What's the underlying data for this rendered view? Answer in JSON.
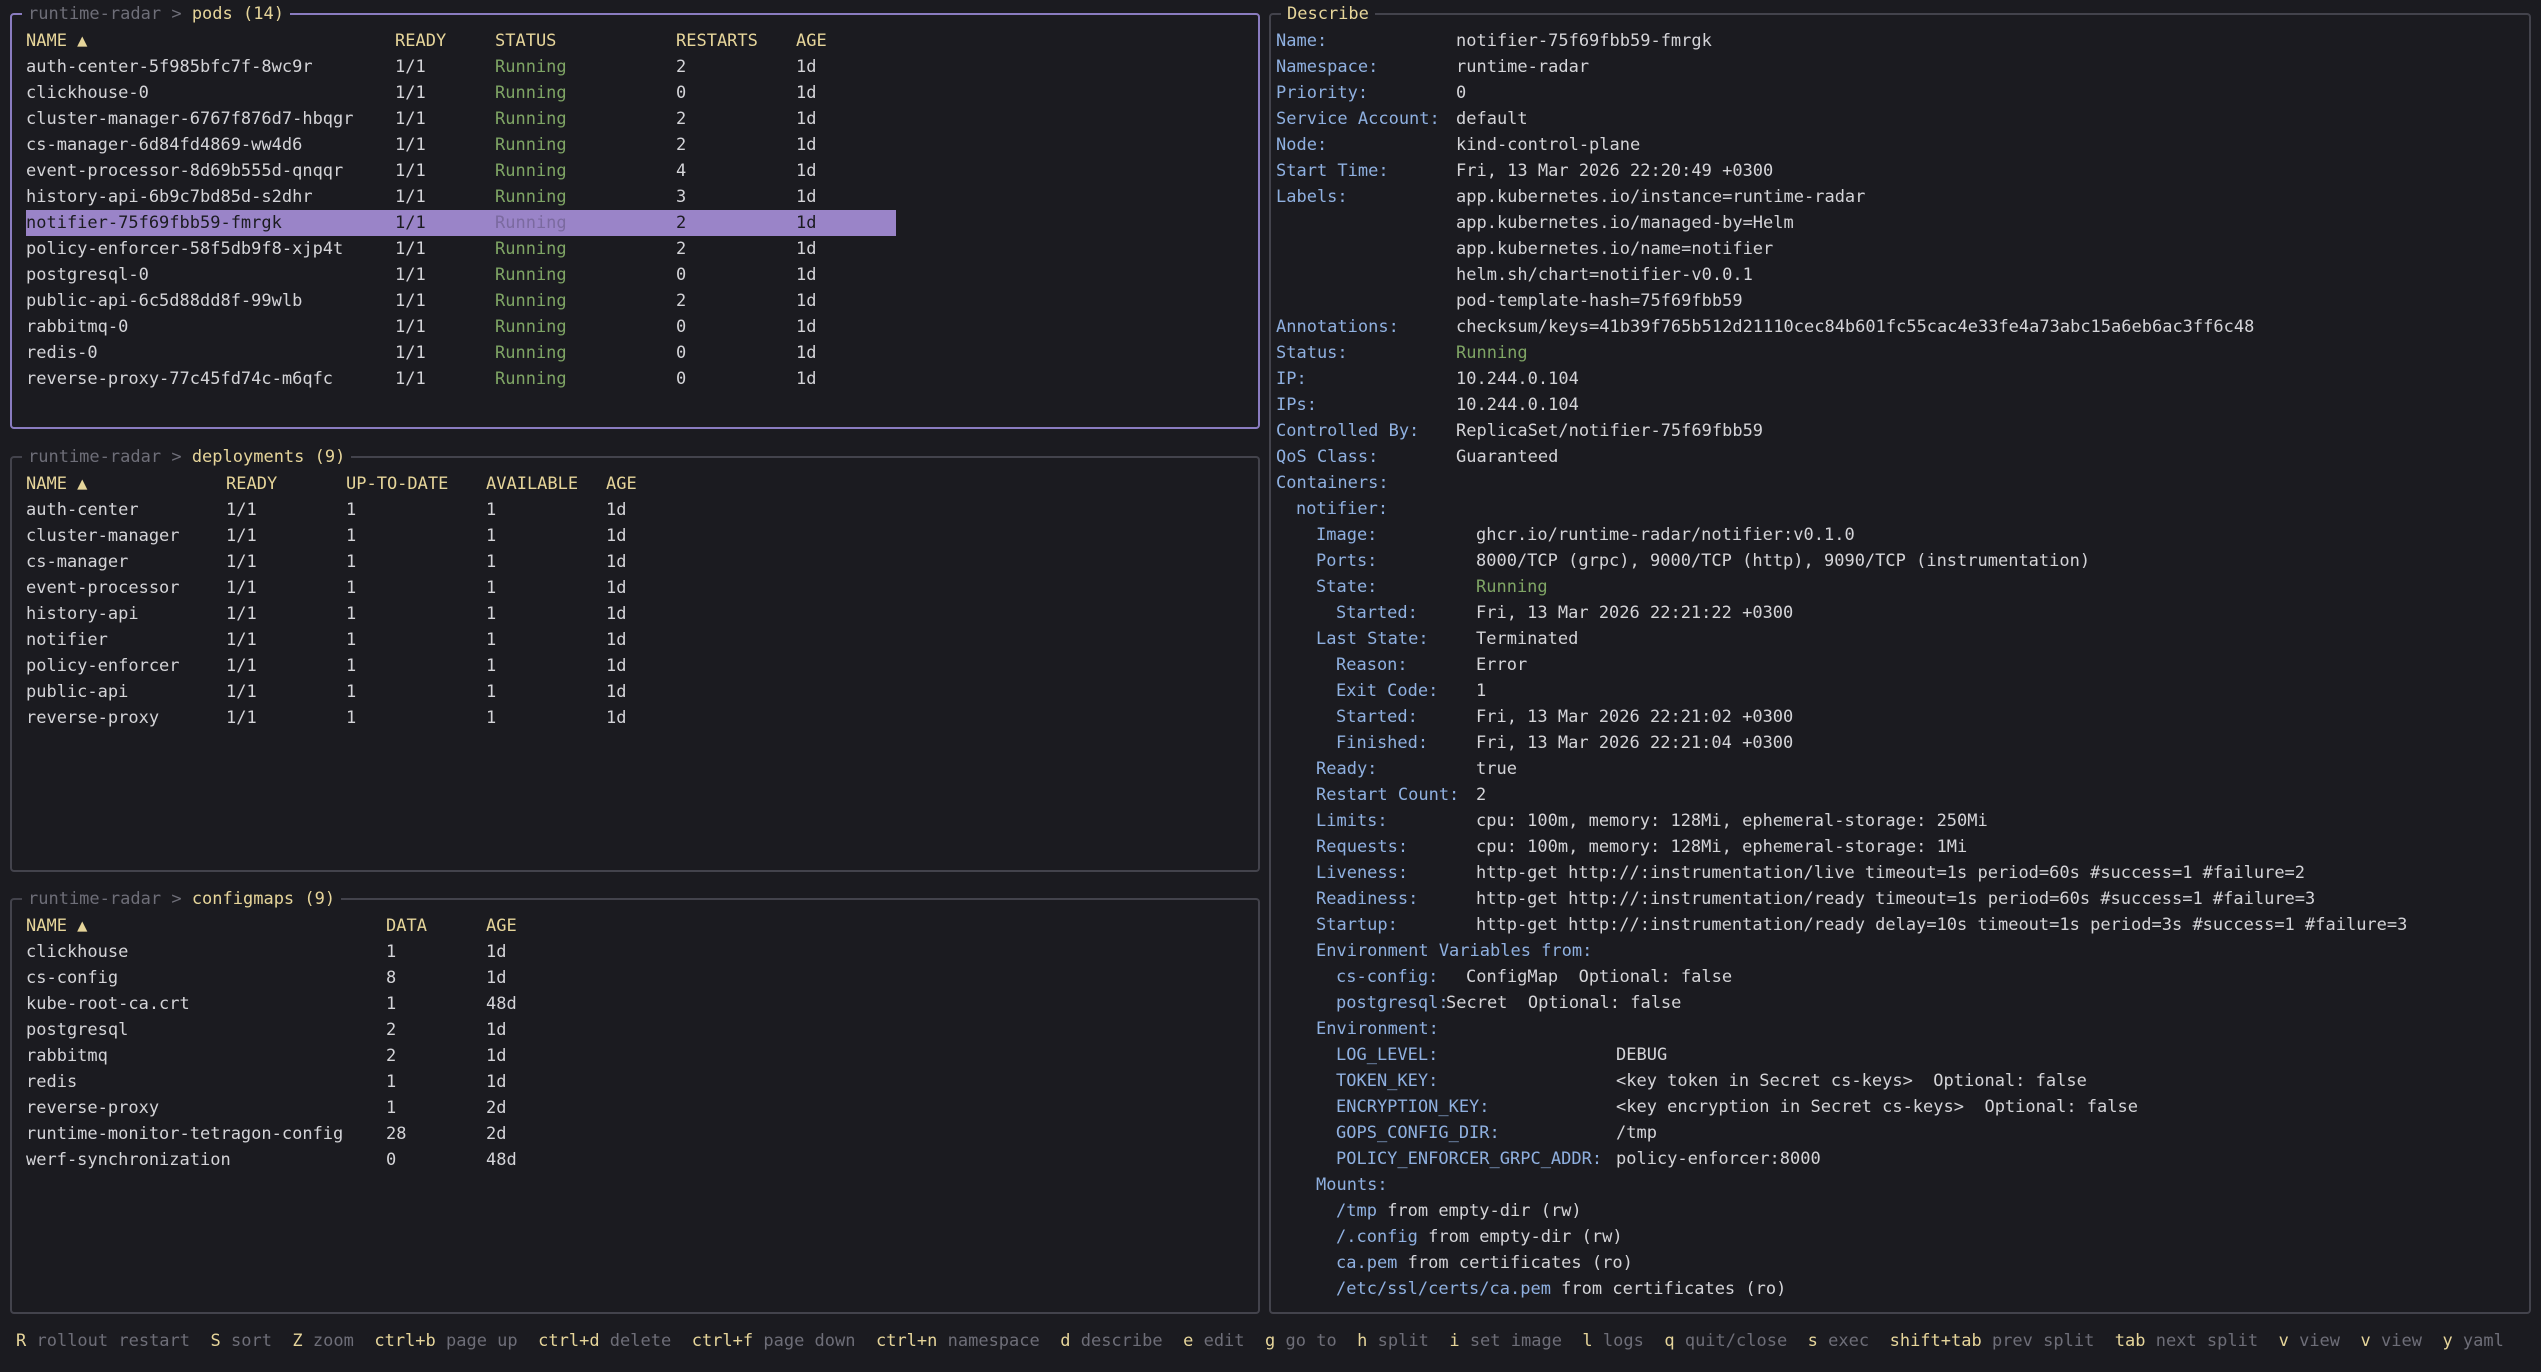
{
  "pods": {
    "namespace": "runtime-radar",
    "sep": ">",
    "resource": "pods",
    "count": "(14)",
    "headers": [
      "NAME ▲",
      "READY",
      "STATUS",
      "RESTARTS",
      "AGE"
    ],
    "rows": [
      [
        "auth-center-5f985bfc7f-8wc9r",
        "1/1",
        "Running",
        "2",
        "1d"
      ],
      [
        "clickhouse-0",
        "1/1",
        "Running",
        "0",
        "1d"
      ],
      [
        "cluster-manager-6767f876d7-hbqgr",
        "1/1",
        "Running",
        "2",
        "1d"
      ],
      [
        "cs-manager-6d84fd4869-ww4d6",
        "1/1",
        "Running",
        "2",
        "1d"
      ],
      [
        "event-processor-8d69b555d-qnqqr",
        "1/1",
        "Running",
        "4",
        "1d"
      ],
      [
        "history-api-6b9c7bd85d-s2dhr",
        "1/1",
        "Running",
        "3",
        "1d"
      ],
      [
        "notifier-75f69fbb59-fmrgk",
        "1/1",
        "Running",
        "2",
        "1d"
      ],
      [
        "policy-enforcer-58f5db9f8-xjp4t",
        "1/1",
        "Running",
        "2",
        "1d"
      ],
      [
        "postgresql-0",
        "1/1",
        "Running",
        "0",
        "1d"
      ],
      [
        "public-api-6c5d88dd8f-99wlb",
        "1/1",
        "Running",
        "2",
        "1d"
      ],
      [
        "rabbitmq-0",
        "1/1",
        "Running",
        "0",
        "1d"
      ],
      [
        "redis-0",
        "1/1",
        "Running",
        "0",
        "1d"
      ],
      [
        "reverse-proxy-77c45fd74c-m6qfc",
        "1/1",
        "Running",
        "0",
        "1d"
      ]
    ]
  },
  "deployments": {
    "namespace": "runtime-radar",
    "sep": ">",
    "resource": "deployments",
    "count": "(9)",
    "headers": [
      "NAME ▲",
      "READY",
      "UP-TO-DATE",
      "AVAILABLE",
      "AGE"
    ],
    "rows": [
      [
        "auth-center",
        "1/1",
        "1",
        "1",
        "1d"
      ],
      [
        "cluster-manager",
        "1/1",
        "1",
        "1",
        "1d"
      ],
      [
        "cs-manager",
        "1/1",
        "1",
        "1",
        "1d"
      ],
      [
        "event-processor",
        "1/1",
        "1",
        "1",
        "1d"
      ],
      [
        "history-api",
        "1/1",
        "1",
        "1",
        "1d"
      ],
      [
        "notifier",
        "1/1",
        "1",
        "1",
        "1d"
      ],
      [
        "policy-enforcer",
        "1/1",
        "1",
        "1",
        "1d"
      ],
      [
        "public-api",
        "1/1",
        "1",
        "1",
        "1d"
      ],
      [
        "reverse-proxy",
        "1/1",
        "1",
        "1",
        "1d"
      ]
    ]
  },
  "configmaps": {
    "namespace": "runtime-radar",
    "sep": ">",
    "resource": "configmaps",
    "count": "(9)",
    "headers": [
      "NAME ▲",
      "DATA",
      "AGE"
    ],
    "rows": [
      [
        "clickhouse",
        "1",
        "1d"
      ],
      [
        "cs-config",
        "8",
        "1d"
      ],
      [
        "kube-root-ca.crt",
        "1",
        "48d"
      ],
      [
        "postgresql",
        "2",
        "1d"
      ],
      [
        "rabbitmq",
        "2",
        "1d"
      ],
      [
        "redis",
        "1",
        "1d"
      ],
      [
        "reverse-proxy",
        "1",
        "2d"
      ],
      [
        "runtime-monitor-tetragon-config",
        "28",
        "2d"
      ],
      [
        "werf-synchronization",
        "0",
        "48d"
      ]
    ]
  },
  "describe": {
    "title": "Describe",
    "lines": [
      {
        "k": "Name:",
        "v": "notifier-75f69fbb59-fmrgk"
      },
      {
        "k": "Namespace:",
        "v": "runtime-radar"
      },
      {
        "k": "Priority:",
        "v": "0"
      },
      {
        "k": "Service Account:",
        "v": "default"
      },
      {
        "k": "Node:",
        "v": "kind-control-plane"
      },
      {
        "k": "Start Time:",
        "v": "Fri, 13 Mar 2026 22:20:49 +0300"
      },
      {
        "k": "Labels:",
        "v": "app.kubernetes.io/instance=runtime-radar"
      },
      {
        "k": "",
        "v": "app.kubernetes.io/managed-by=Helm"
      },
      {
        "k": "",
        "v": "app.kubernetes.io/name=notifier"
      },
      {
        "k": "",
        "v": "helm.sh/chart=notifier-v0.0.1"
      },
      {
        "k": "",
        "v": "pod-template-hash=75f69fbb59"
      },
      {
        "k": "Annotations:",
        "v": "checksum/keys=41b39f765b512d21110cec84b601fc55cac4e33fe4a73abc15a6eb6ac3ff6c48"
      },
      {
        "k": "Status:",
        "v": "Running"
      },
      {
        "k": "IP:",
        "v": "10.244.0.104"
      },
      {
        "k": "IPs:",
        "v": "10.244.0.104"
      },
      {
        "k": "Controlled By:",
        "v": "ReplicaSet/notifier-75f69fbb59"
      },
      {
        "k": "QoS Class:",
        "v": "Guaranteed"
      },
      {
        "k": "Containers:",
        "v": ""
      },
      {
        "k": "notifier:",
        "v": ""
      },
      {
        "k": "Image:",
        "v": "ghcr.io/runtime-radar/notifier:v0.1.0"
      },
      {
        "k": "Ports:",
        "v": "8000/TCP (grpc), 9000/TCP (http), 9090/TCP (instrumentation)"
      },
      {
        "k": "State:",
        "v": "Running"
      },
      {
        "k": "Started:",
        "v": "Fri, 13 Mar 2026 22:21:22 +0300"
      },
      {
        "k": "Last State:",
        "v": "Terminated"
      },
      {
        "k": "Reason:",
        "v": "Error"
      },
      {
        "k": "Exit Code:",
        "v": "1"
      },
      {
        "k": "Started:",
        "v": "Fri, 13 Mar 2026 22:21:02 +0300"
      },
      {
        "k": "Finished:",
        "v": "Fri, 13 Mar 2026 22:21:04 +0300"
      },
      {
        "k": "Ready:",
        "v": "true"
      },
      {
        "k": "Restart Count:",
        "v": "2"
      },
      {
        "k": "Limits:",
        "v": "cpu: 100m, memory: 128Mi, ephemeral-storage: 250Mi"
      },
      {
        "k": "Requests:",
        "v": "cpu: 100m, memory: 128Mi, ephemeral-storage: 1Mi"
      },
      {
        "k": "Liveness:",
        "v": "http-get http://:instrumentation/live timeout=1s period=60s #success=1 #failure=2"
      },
      {
        "k": "Readiness:",
        "v": "http-get http://:instrumentation/ready timeout=1s period=60s #success=1 #failure=3"
      },
      {
        "k": "Startup:",
        "v": "http-get http://:instrumentation/ready delay=10s timeout=1s period=3s #success=1 #failure=3"
      },
      {
        "k": "Environment Variables from:",
        "v": ""
      },
      {
        "k": "cs-config:",
        "v": "ConfigMap  Optional: false"
      },
      {
        "k": "postgresql:",
        "v": "Secret  Optional: false"
      },
      {
        "k": "Environment:",
        "v": ""
      },
      {
        "k": "LOG_LEVEL:",
        "v": "DEBUG"
      },
      {
        "k": "TOKEN_KEY:",
        "v": "<key token in Secret cs-keys>  Optional: false"
      },
      {
        "k": "ENCRYPTION_KEY:",
        "v": "<key encryption in Secret cs-keys>  Optional: false"
      },
      {
        "k": "GOPS_CONFIG_DIR:",
        "v": "/tmp"
      },
      {
        "k": "POLICY_ENFORCER_GRPC_ADDR:",
        "v": "policy-enforcer:8000"
      },
      {
        "k": "Mounts:",
        "v": ""
      },
      {
        "k": "/tmp",
        "v": "from empty-dir (rw)"
      },
      {
        "k": "/.config",
        "v": "from empty-dir (rw)"
      },
      {
        "k": "ca.pem",
        "v": "from certificates (ro)"
      },
      {
        "k": "/etc/ssl/certs/ca.pem",
        "v": "from certificates (ro)"
      }
    ]
  },
  "footer": [
    {
      "key": "R",
      "desc": "rollout restart"
    },
    {
      "key": "S",
      "desc": "sort"
    },
    {
      "key": "Z",
      "desc": "zoom"
    },
    {
      "key": "ctrl+b",
      "desc": "page up"
    },
    {
      "key": "ctrl+d",
      "desc": "delete"
    },
    {
      "key": "ctrl+f",
      "desc": "page down"
    },
    {
      "key": "ctrl+n",
      "desc": "namespace"
    },
    {
      "key": "d",
      "desc": "describe"
    },
    {
      "key": "e",
      "desc": "edit"
    },
    {
      "key": "g",
      "desc": "go to"
    },
    {
      "key": "h",
      "desc": "split"
    },
    {
      "key": "i",
      "desc": "set image"
    },
    {
      "key": "l",
      "desc": "logs"
    },
    {
      "key": "q",
      "desc": "quit/close"
    },
    {
      "key": "s",
      "desc": "exec"
    },
    {
      "key": "shift+tab",
      "desc": "prev split"
    },
    {
      "key": "tab",
      "desc": "next split"
    },
    {
      "key": "v",
      "desc": "view"
    },
    {
      "key": "v",
      "desc": "view"
    },
    {
      "key": "y",
      "desc": "yaml"
    }
  ],
  "colors": {
    "background": "#1b1b20",
    "header": "#e6d59a",
    "running": "#7fa565",
    "selection": "#9a84c8",
    "describe_key": "#8fb0e0",
    "border_active": "#8a7cc0"
  }
}
